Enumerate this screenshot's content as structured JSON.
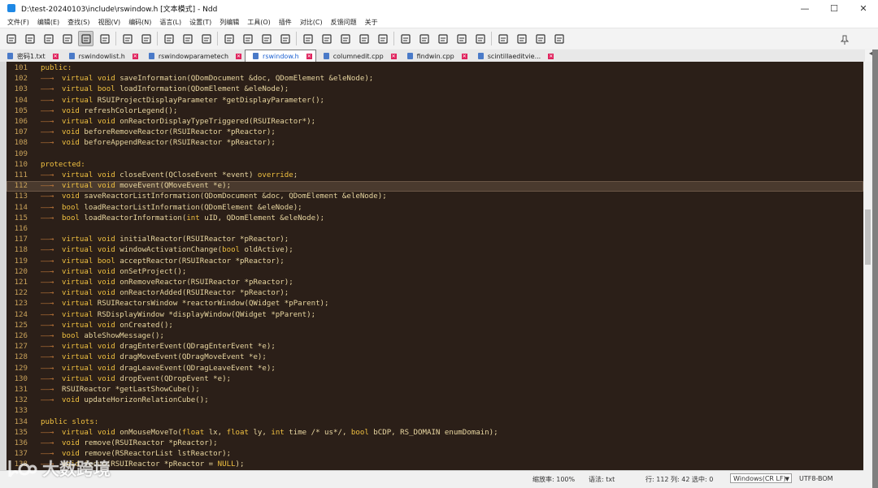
{
  "window": {
    "title": "D:\\test-20240103\\include\\rswindow.h [文本模式] - Ndd",
    "controls": {
      "minimize": "—",
      "maximize": "☐",
      "close": "✕"
    }
  },
  "menu": [
    "文件(F)",
    "编辑(E)",
    "查找(S)",
    "视图(V)",
    "编码(N)",
    "语言(L)",
    "设置(T)",
    "列编辑",
    "工具(O)",
    "插件",
    "对比(C)",
    "反馈问题",
    "关于"
  ],
  "toolbar": {
    "buttons": [
      "new-file-icon",
      "open-folder-icon",
      "save-icon",
      "save-all-icon",
      "close-file-icon",
      "close-all-icon",
      "undo-icon",
      "redo-icon",
      "find-icon",
      "replace-icon",
      "goto-icon",
      "word-wrap-icon",
      "show-symbols-icon",
      "zoom-in-icon",
      "zoom-out-icon",
      "indent-guide-icon",
      "font-icon",
      "indent-icon",
      "format-icon",
      "prev-icon",
      "next-icon",
      "split-panel-icon",
      "compare-icon",
      "sync-scroll-icon",
      "play-macro-icon",
      "stop-macro-icon",
      "pause-icon",
      "fast-forward-icon",
      "save-macro-icon"
    ],
    "active_index": 4,
    "pin_icon": "pin-icon"
  },
  "tabs": [
    {
      "label": "密码1.txt",
      "active": false
    },
    {
      "label": "rswindowlist.h",
      "active": false
    },
    {
      "label": "rswindowparametech",
      "active": false
    },
    {
      "label": "rswindow.h",
      "active": true
    },
    {
      "label": "columnedit.cpp",
      "active": false
    },
    {
      "label": "findwin.cpp",
      "active": false
    },
    {
      "label": "scintillaeditvie...",
      "active": false
    }
  ],
  "editor": {
    "current_line": 112,
    "lines": [
      {
        "n": "101",
        "t": "public:"
      },
      {
        "n": "102",
        "t": "virtual void saveInformation(QDomDocument &doc, QDomElement &eleNode);"
      },
      {
        "n": "103",
        "t": "virtual bool loadInformation(QDomElement &eleNode);"
      },
      {
        "n": "104",
        "t": "virtual RSUIProjectDisplayParameter *getDisplayParameter();"
      },
      {
        "n": "105",
        "t": "void refreshColorLegend();"
      },
      {
        "n": "106",
        "t": "virtual void onReactorDisplayTypeTriggered(RSUIReactor*);"
      },
      {
        "n": "107",
        "t": "void beforeRemoveReactor(RSUIReactor *pReactor);"
      },
      {
        "n": "108",
        "t": "void beforeAppendReactor(RSUIReactor *pReactor);"
      },
      {
        "n": "109",
        "t": ""
      },
      {
        "n": "110",
        "t": "protected:"
      },
      {
        "n": "111",
        "t": "virtual void closeEvent(QCloseEvent *event) override;"
      },
      {
        "n": "112",
        "t": "virtual void moveEvent(QMoveEvent *e);"
      },
      {
        "n": "113",
        "t": "void saveReactorListInformation(QDomDocument &doc, QDomElement &eleNode);"
      },
      {
        "n": "114",
        "t": "bool loadReactorListInformation(QDomElement &eleNode);"
      },
      {
        "n": "115",
        "t": "bool loadReactorInformation(int uID, QDomElement &eleNode);"
      },
      {
        "n": "116",
        "t": ""
      },
      {
        "n": "117",
        "t": "virtual void initialReactor(RSUIReactor *pReactor);"
      },
      {
        "n": "118",
        "t": "virtual void windowActivationChange(bool oldActive);"
      },
      {
        "n": "119",
        "t": "virtual bool acceptReactor(RSUIReactor *pReactor);"
      },
      {
        "n": "120",
        "t": "virtual void onSetProject();"
      },
      {
        "n": "121",
        "t": "virtual void onRemoveReactor(RSUIReactor *pReactor);"
      },
      {
        "n": "122",
        "t": "virtual void onReactorAdded(RSUIReactor *pReactor);"
      },
      {
        "n": "123",
        "t": "virtual RSUIReactorsWindow *reactorWindow(QWidget *pParent);"
      },
      {
        "n": "124",
        "t": "virtual RSDisplayWindow *displayWindow(QWidget *pParent);"
      },
      {
        "n": "125",
        "t": "virtual void onCreated();"
      },
      {
        "n": "126",
        "t": "bool ableShowMessage();"
      },
      {
        "n": "127",
        "t": "virtual void dragEnterEvent(QDragEnterEvent *e);"
      },
      {
        "n": "128",
        "t": "virtual void dragMoveEvent(QDragMoveEvent *e);"
      },
      {
        "n": "129",
        "t": "virtual void dragLeaveEvent(QDragLeaveEvent *e);"
      },
      {
        "n": "130",
        "t": "virtual void dropEvent(QDropEvent *e);"
      },
      {
        "n": "131",
        "t": "RSUIReactor *getLastShowCube();"
      },
      {
        "n": "132",
        "t": "void updateHorizonRelationCube();"
      },
      {
        "n": "133",
        "t": ""
      },
      {
        "n": "134",
        "t": "public slots:"
      },
      {
        "n": "135",
        "t": "virtual void onMouseMoveTo(float lx, float ly, int time /* us*/, bool bCDP, RS_DOMAIN enumDomain);"
      },
      {
        "n": "136",
        "t": "void remove(RSUIReactor *pReactor);"
      },
      {
        "n": "137",
        "t": "void remove(RSReactorList lstReactor);"
      },
      {
        "n": "138",
        "t": "void focus(RSUIReactor *pReactor = NULL);"
      }
    ]
  },
  "status": {
    "zoom": "缩放率: 100%",
    "syntax": "语法: txt",
    "position": "行: 112 列: 42 选中: 0",
    "eol": "Windows(CR LF)",
    "encoding": "UTF8-BOM"
  },
  "watermark": {
    "text": "大数跨境"
  },
  "colors": {
    "editor_bg": "#2b1f18",
    "keyword": "#f0c040",
    "line_number": "#c9a25a",
    "tab_active_text": "#1a5fd1"
  }
}
